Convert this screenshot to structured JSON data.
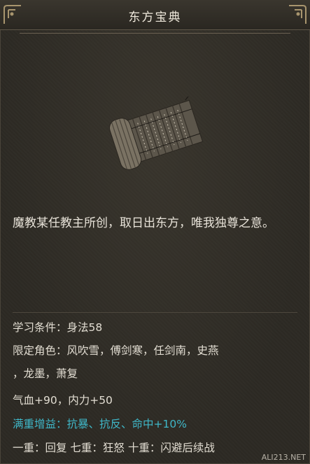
{
  "header": {
    "title": "东方宝典"
  },
  "item": {
    "icon": "scroll-book-icon",
    "description": "魔教某任教主所创，取日出东方，唯我独尊之意。"
  },
  "stats": {
    "requirement": "学习条件：身法58",
    "roles_line1": "限定角色：风吹雪，傅剑寒，任剑南，史燕",
    "roles_line2": "，龙墨，萧复",
    "bonus": "气血+90，内力+50",
    "full_bonus": "满重增益：抗暴、抗反、命中+10%",
    "tiers": "一重：回复 七重：狂怒 十重：闪避后续战"
  },
  "watermark": "ALI213.NET",
  "colors": {
    "background": "#2d2a24",
    "text": "#e6e1d8",
    "highlight": "#3fb7c8"
  }
}
